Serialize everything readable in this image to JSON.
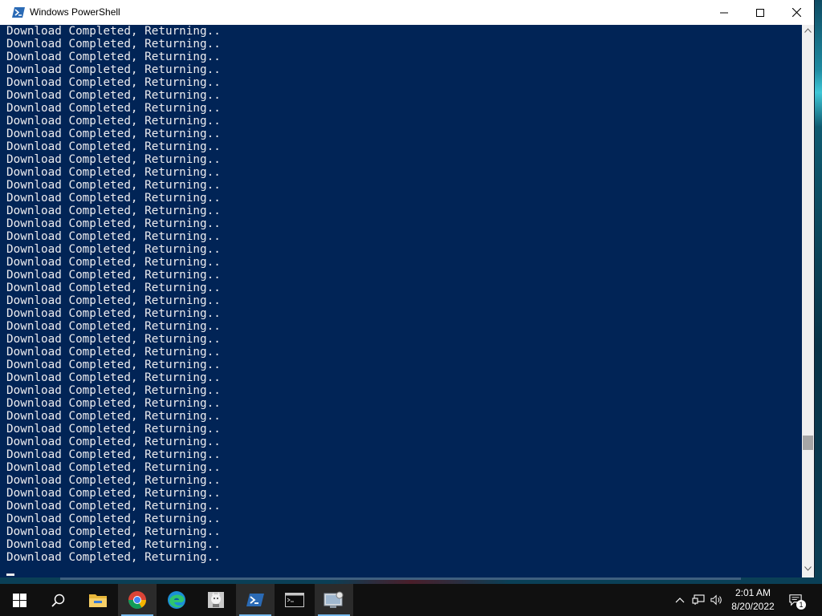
{
  "window": {
    "title": "Windows PowerShell",
    "controls": [
      "minimize",
      "maximize",
      "close"
    ]
  },
  "console": {
    "lines": [
      "Download Completed, Returning..",
      "Download Completed, Returning..",
      "Download Completed, Returning..",
      "Download Completed, Returning..",
      "Download Completed, Returning..",
      "Download Completed, Returning..",
      "Download Completed, Returning..",
      "Download Completed, Returning..",
      "Download Completed, Returning..",
      "Download Completed, Returning..",
      "Download Completed, Returning..",
      "Download Completed, Returning..",
      "Download Completed, Returning..",
      "Download Completed, Returning..",
      "Download Completed, Returning..",
      "Download Completed, Returning..",
      "Download Completed, Returning..",
      "Download Completed, Returning..",
      "Download Completed, Returning..",
      "Download Completed, Returning..",
      "Download Completed, Returning..",
      "Download Completed, Returning..",
      "Download Completed, Returning..",
      "Download Completed, Returning..",
      "Download Completed, Returning..",
      "Download Completed, Returning..",
      "Download Completed, Returning..",
      "Download Completed, Returning..",
      "Download Completed, Returning..",
      "Download Completed, Returning..",
      "Download Completed, Returning..",
      "Download Completed, Returning..",
      "Download Completed, Returning..",
      "Download Completed, Returning..",
      "Download Completed, Returning..",
      "Download Completed, Returning..",
      "Download Completed, Returning..",
      "Download Completed, Returning..",
      "Download Completed, Returning..",
      "Download Completed, Returning..",
      "Download Completed, Returning..",
      "Download Completed, Returning.."
    ],
    "background_color": "#012456",
    "text_color": "#eeedf0"
  },
  "taskbar": {
    "apps": [
      {
        "name": "start",
        "icon": "windows-logo-icon",
        "active": false
      },
      {
        "name": "search",
        "icon": "search-icon",
        "active": false
      },
      {
        "name": "file-explorer",
        "icon": "folder-icon",
        "active": false
      },
      {
        "name": "chrome",
        "icon": "chrome-icon",
        "active": true
      },
      {
        "name": "edge",
        "icon": "edge-icon",
        "active": false
      },
      {
        "name": "app-mascot",
        "icon": "mascot-icon",
        "active": false
      },
      {
        "name": "powershell",
        "icon": "powershell-icon",
        "active": true
      },
      {
        "name": "command-prompt",
        "icon": "cmd-icon",
        "active": false
      },
      {
        "name": "remote-app",
        "icon": "remote-desktop-icon",
        "active": true
      }
    ],
    "tray": {
      "time": "2:01 AM",
      "date": "8/20/2022",
      "notification_count": "1"
    }
  }
}
